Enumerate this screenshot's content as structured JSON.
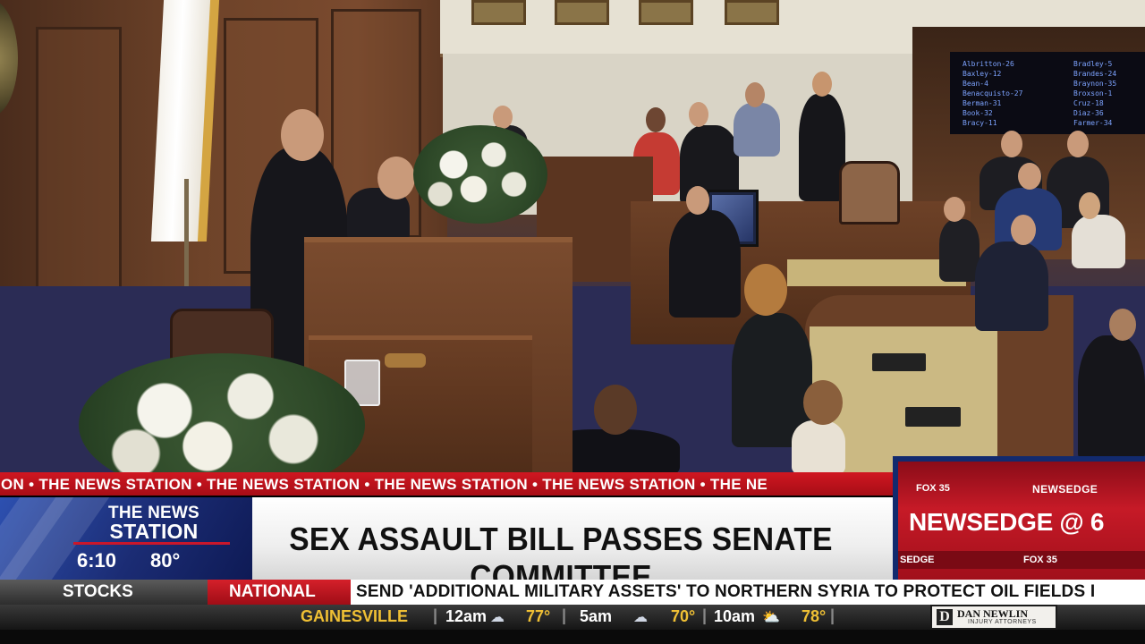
{
  "ticker_banner": {
    "text": "ATION  •  THE NEWS STATION  •  THE NEWS STATION  •  THE NEWS STATION  •  THE NEWS STATION  •  THE NE"
  },
  "station": {
    "name_line1": "THE NEWS",
    "name_line2": "STATION",
    "time": "6:10",
    "temperature": "80°"
  },
  "headline": "SEX ASSAULT BILL PASSES SENATE COMMITTEE",
  "promo": {
    "top_left": "FOX 35",
    "top_right": "NEWSEDGE",
    "title": "NEWSEDGE @ 6",
    "bottom_left": "SEDGE",
    "bottom_right": "FOX 35"
  },
  "crawl": {
    "stocks_label": "STOCKS",
    "category": "NATIONAL",
    "text": "SEND 'ADDITIONAL MILITARY ASSETS' TO NORTHERN SYRIA TO PROTECT OIL FIELDS I"
  },
  "weather": {
    "city": "GAINESVILLE",
    "forecast": [
      {
        "time": "12am",
        "icon": "partly-cloudy-night-icon",
        "temp": "77°"
      },
      {
        "time": "5am",
        "icon": "cloudy-icon",
        "temp": "70°"
      },
      {
        "time": "10am",
        "icon": "partly-sunny-icon",
        "temp": "78°"
      }
    ]
  },
  "sponsor": {
    "name": "DAN NEWLIN",
    "tagline": "INJURY ATTORNEYS"
  },
  "vote_board": {
    "column_left": "Albritton-26\nBaxley-12\nBean-4\nBenacquisto-27\nBerman-31\nBook-32\nBracy-11",
    "column_right": "Bradley-5\nBrandes-24\nBraynon-35\nBroxson-1\nCruz-18\nDiaz-36\nFarmer-34"
  },
  "colors": {
    "ticker_red": "#c01520",
    "station_blue": "#1b2c74",
    "weather_gold": "#f0c034"
  }
}
